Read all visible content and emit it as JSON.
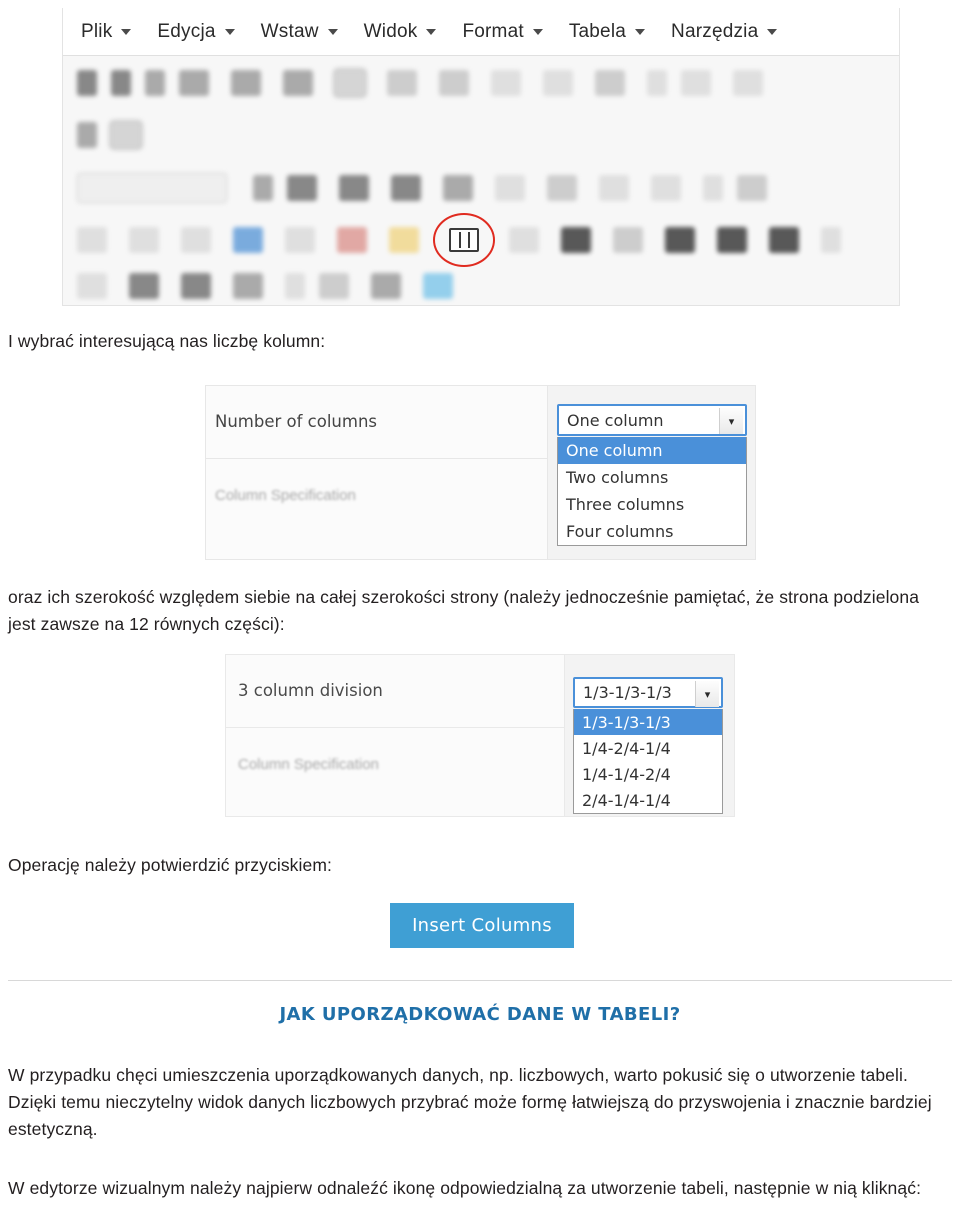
{
  "toolbar": {
    "menu": [
      {
        "label": "Plik"
      },
      {
        "label": "Edycja"
      },
      {
        "label": "Wstaw"
      },
      {
        "label": "Widok"
      },
      {
        "label": "Format"
      },
      {
        "label": "Tabela"
      },
      {
        "label": "Narzędzia"
      }
    ],
    "highlighted_tool": "insert-columns-icon"
  },
  "text": {
    "p1": "I wybrać interesującą nas liczbę kolumn:",
    "p2": "oraz ich szerokość względem siebie na całej szerokości strony (należy jednocześnie pamiętać, że strona podzielona jest zawsze na 12 równych części):",
    "p3": "Operację należy potwierdzić przyciskiem:",
    "heading": "JAK UPORZĄDKOWAĆ DANE W TABELI?",
    "p5": "W przypadku chęci umieszczenia uporządkowanych danych, np. liczbowych, warto pokusić się o utworzenie tabeli. Dzięki temu nieczytelny widok danych liczbowych przybrać może formę łatwiejszą do przyswojenia i znacznie bardziej estetyczną.",
    "p6": "W edytorze wizualnym należy najpierw odnaleźć ikonę odpowiedzialną za utworzenie tabeli, następnie w nią kliknąć:"
  },
  "dialog_columns": {
    "label": "Number of columns",
    "sub_label": "Column Specification",
    "select_value": "One column",
    "options": [
      {
        "label": "One column",
        "selected": true
      },
      {
        "label": "Two columns",
        "selected": false
      },
      {
        "label": "Three columns",
        "selected": false
      },
      {
        "label": "Four columns",
        "selected": false
      }
    ]
  },
  "dialog_division": {
    "label": "3 column division",
    "sub_label": "Column Specification",
    "select_value": "1/3-1/3-1/3",
    "options": [
      {
        "label": "1/3-1/3-1/3",
        "selected": true
      },
      {
        "label": "1/4-2/4-1/4",
        "selected": false
      },
      {
        "label": "1/4-1/4-2/4",
        "selected": false
      },
      {
        "label": "2/4-1/4-1/4",
        "selected": false
      }
    ]
  },
  "insert_button": {
    "label": "Insert Columns",
    "color": "#3f9fd4"
  }
}
